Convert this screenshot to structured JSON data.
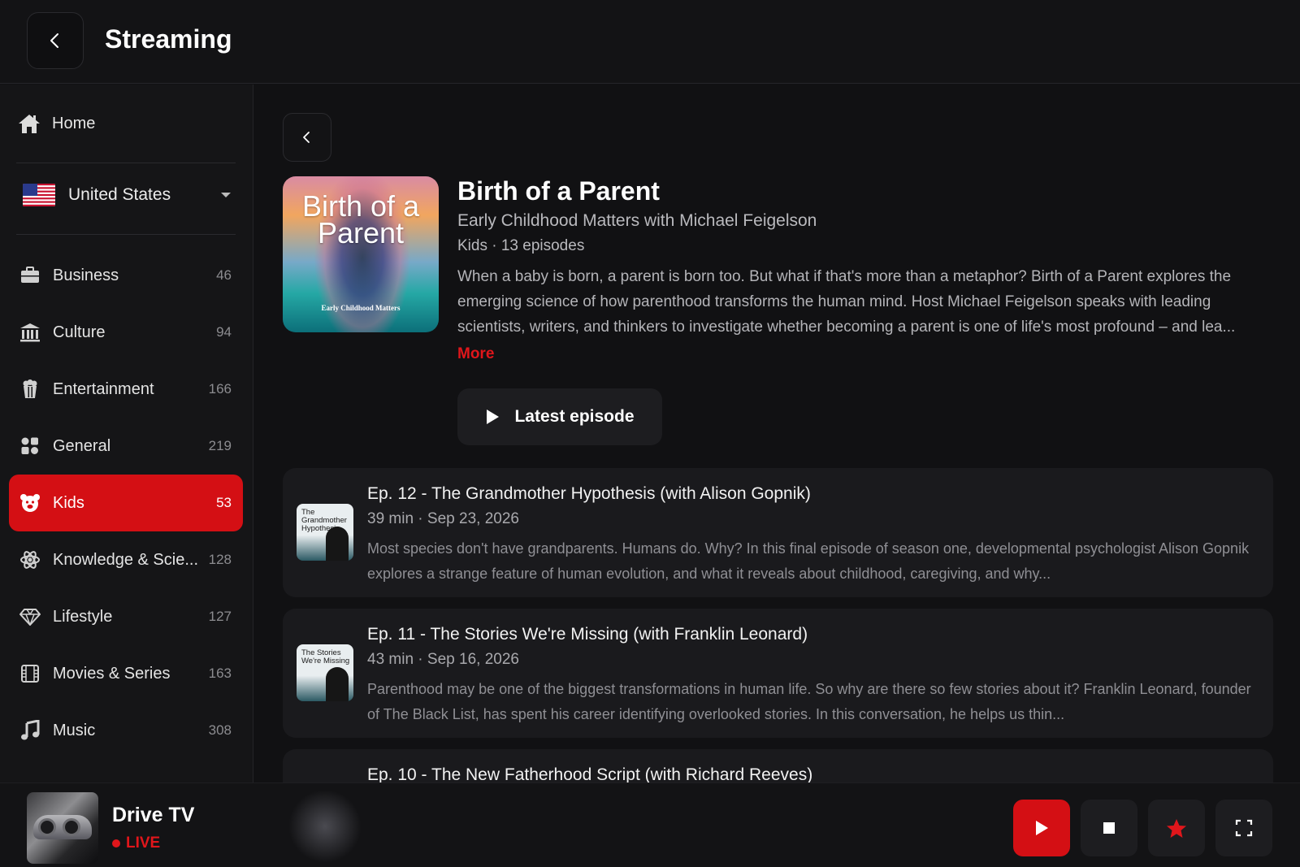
{
  "header": {
    "title": "Streaming"
  },
  "sidebar": {
    "home_label": "Home",
    "country": "United States",
    "categories": [
      {
        "label": "Business",
        "count": "46",
        "icon": "briefcase-icon"
      },
      {
        "label": "Culture",
        "count": "94",
        "icon": "museum-icon"
      },
      {
        "label": "Entertainment",
        "count": "166",
        "icon": "popcorn-icon"
      },
      {
        "label": "General",
        "count": "219",
        "icon": "grid-icon"
      },
      {
        "label": "Kids",
        "count": "53",
        "icon": "bear-icon",
        "active": true
      },
      {
        "label": "Knowledge & Scie...",
        "count": "128",
        "icon": "atom-icon"
      },
      {
        "label": "Lifestyle",
        "count": "127",
        "icon": "diamond-icon"
      },
      {
        "label": "Movies & Series",
        "count": "163",
        "icon": "film-icon"
      },
      {
        "label": "Music",
        "count": "308",
        "icon": "music-note-icon"
      }
    ]
  },
  "podcast": {
    "cover_title": "Birth of a Parent",
    "cover_subtitle": "Early Childhood Matters",
    "title": "Birth of a Parent",
    "author": "Early Childhood Matters with Michael Feigelson",
    "meta": "Kids · 13 episodes",
    "description": "When a baby is born, a parent is born too. But what if that's more than a metaphor? Birth of a Parent explores the emerging science of how parenthood transforms the human mind. Host Michael Feigelson speaks with leading scientists, writers, and thinkers to investigate whether becoming a parent is one of life's most profound – and lea...",
    "more_label": "More",
    "latest_label": "Latest episode"
  },
  "episodes": [
    {
      "thumb_text": "The Grandmother Hypothesis",
      "title": "Ep. 12 - The Grandmother Hypothesis (with Alison Gopnik)",
      "meta": "39 min · Sep 23, 2026",
      "description": "Most species don't have grandparents. Humans do. Why? In this final episode of season one, developmental psychologist Alison Gopnik explores a strange feature of human evolution, and what it reveals about childhood, caregiving, and why..."
    },
    {
      "thumb_text": "The Stories We're Missing",
      "title": "Ep. 11 - The Stories We're Missing (with Franklin Leonard)",
      "meta": "43 min · Sep 16, 2026",
      "description": "Parenthood may be one of the biggest transformations in human life. So why are there so few stories about it? Franklin Leonard, founder of The Black List, has spent his career identifying overlooked stories. In this conversation, he helps us thin..."
    },
    {
      "thumb_text": "",
      "title": "Ep. 10 - The New Fatherhood Script (with Richard Reeves)",
      "meta": "",
      "description": ""
    }
  ],
  "player": {
    "station": "Drive TV",
    "status": "LIVE",
    "accent": "#d40f14"
  }
}
